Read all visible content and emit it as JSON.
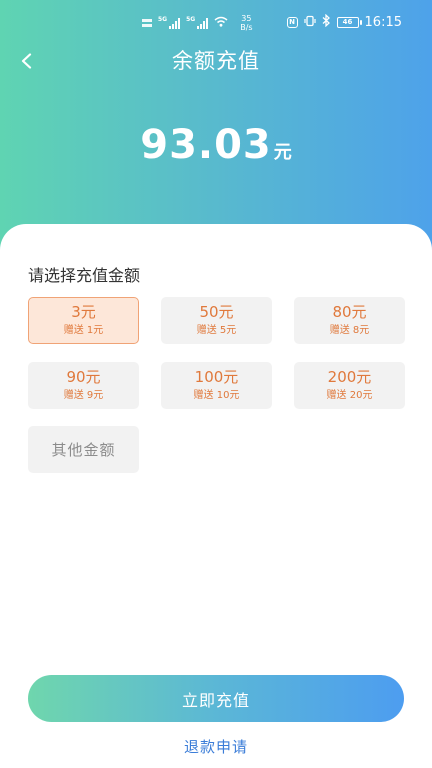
{
  "status_bar": {
    "sim1_tag": "5G",
    "sim2_tag": "5G",
    "net_speed_value": "35",
    "net_speed_unit": "B/s",
    "nfc_icon": "N",
    "vibrate_icon": "vibrate",
    "bluetooth_icon": "bluetooth",
    "battery_level": "46",
    "time": "16:15"
  },
  "nav": {
    "back_icon": "chevron-left-icon",
    "title": "余额充值"
  },
  "balance": {
    "amount": "93.03",
    "unit": "元"
  },
  "recharge": {
    "section_title": "请选择充值金额",
    "bonus_prefix": "赠送",
    "options": [
      {
        "amount": "3元",
        "bonus": "1元",
        "selected": true
      },
      {
        "amount": "50元",
        "bonus": "5元",
        "selected": false
      },
      {
        "amount": "80元",
        "bonus": "8元",
        "selected": false
      },
      {
        "amount": "90元",
        "bonus": "9元",
        "selected": false
      },
      {
        "amount": "100元",
        "bonus": "10元",
        "selected": false
      },
      {
        "amount": "200元",
        "bonus": "20元",
        "selected": false
      }
    ],
    "other_label": "其他金额",
    "submit_label": "立即充值",
    "refund_label": "退款申请"
  },
  "colors": {
    "accent_orange": "#e0793c",
    "selected_bg": "#fde7d9",
    "link_blue": "#3b7dd8"
  }
}
